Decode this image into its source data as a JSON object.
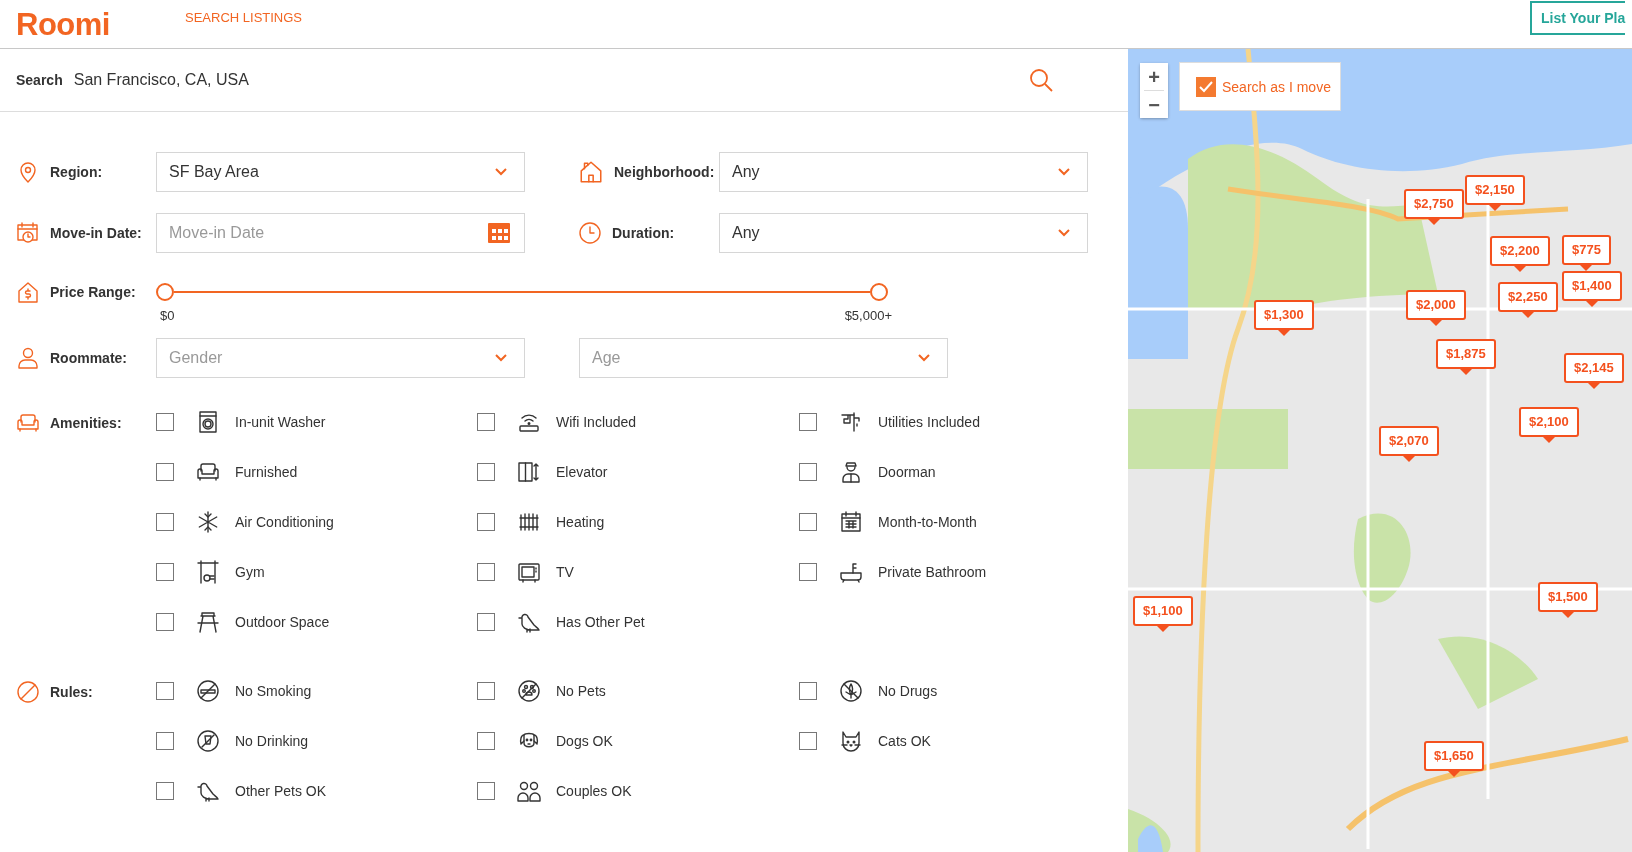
{
  "header": {
    "logo": "Roomi",
    "nav_link": "SEARCH LISTINGS",
    "button": "List Your Pla"
  },
  "search": {
    "label": "Search",
    "value": "San Francisco, CA, USA"
  },
  "filters": {
    "region": {
      "label": "Region:",
      "value": "SF Bay Area"
    },
    "neighborhood": {
      "label": "Neighborhood:",
      "value": "Any"
    },
    "move_in": {
      "label": "Move-in Date:",
      "placeholder": "Move-in Date"
    },
    "duration": {
      "label": "Duration:",
      "value": "Any"
    },
    "price_range": {
      "label": "Price Range:",
      "min_label": "$0",
      "max_label": "$5,000+",
      "thumbs": [
        {
          "level": 0
        },
        {
          "level": 1
        }
      ]
    },
    "roommate": {
      "label": "Roommate:",
      "gender": {
        "placeholder": "Gender"
      },
      "age": {
        "placeholder": "Age"
      }
    },
    "amenities": {
      "label": "Amenities:",
      "options": [
        {
          "label": "In-unit Washer",
          "checked": false
        },
        {
          "label": "Wifi Included",
          "checked": false
        },
        {
          "label": "Utilities Included",
          "checked": false
        },
        {
          "label": "Furnished",
          "checked": false
        },
        {
          "label": "Elevator",
          "checked": false
        },
        {
          "label": "Doorman",
          "checked": false
        },
        {
          "label": "Air Conditioning",
          "checked": false
        },
        {
          "label": "Heating",
          "checked": false
        },
        {
          "label": "Month-to-Month",
          "checked": false
        },
        {
          "label": "Gym",
          "checked": false
        },
        {
          "label": "TV",
          "checked": false
        },
        {
          "label": "Private Bathroom",
          "checked": false
        },
        {
          "label": "Outdoor Space",
          "checked": false
        },
        {
          "label": "Has Other Pet",
          "checked": false
        }
      ]
    },
    "rules": {
      "label": "Rules:",
      "options": [
        {
          "label": "No Smoking",
          "checked": false
        },
        {
          "label": "No Pets",
          "checked": false
        },
        {
          "label": "No Drugs",
          "checked": false
        },
        {
          "label": "No Drinking",
          "checked": false
        },
        {
          "label": "Dogs OK",
          "checked": false
        },
        {
          "label": "Cats OK",
          "checked": false
        },
        {
          "label": "Other Pets OK",
          "checked": false
        },
        {
          "label": "Couples OK",
          "checked": false
        }
      ]
    }
  },
  "map": {
    "zoom_in": "+",
    "zoom_out": "−",
    "search_as_i_move": {
      "label": "Search as I move",
      "checked": true
    },
    "markers": [
      {
        "price": "$2,750"
      },
      {
        "price": "$2,150"
      },
      {
        "price": "$2,200"
      },
      {
        "price": "$775"
      },
      {
        "price": "$1,400"
      },
      {
        "price": "$2,250"
      },
      {
        "price": "$2,000"
      },
      {
        "price": "$1,300"
      },
      {
        "price": "$1,875"
      },
      {
        "price": "$2,145"
      },
      {
        "price": "$2,100"
      },
      {
        "price": "$2,070"
      },
      {
        "price": "$1,100"
      },
      {
        "price": "$1,500"
      },
      {
        "price": "$1,650"
      }
    ]
  }
}
